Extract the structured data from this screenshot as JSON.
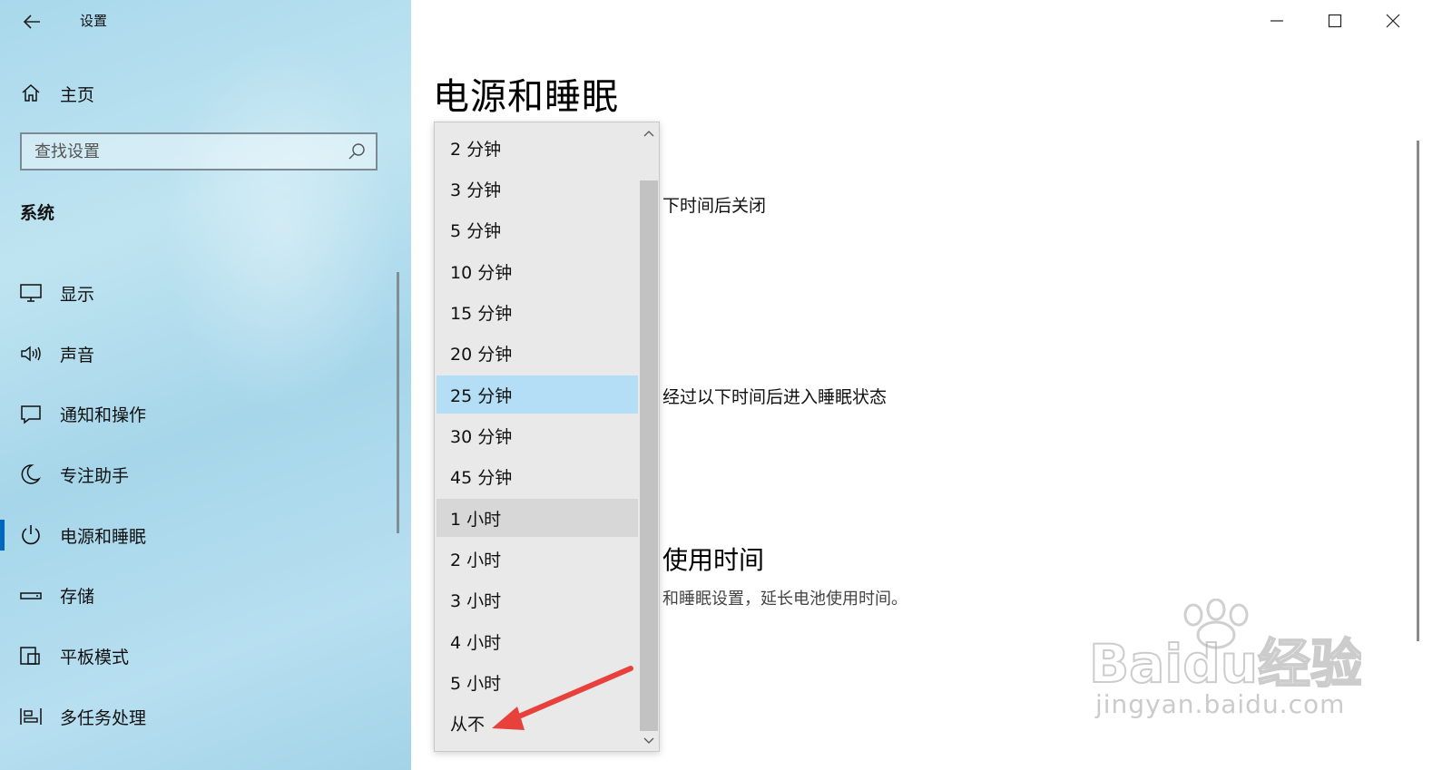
{
  "window": {
    "title": "设置"
  },
  "sidebar": {
    "home_label": "主页",
    "search_placeholder": "查找设置",
    "section_header": "系统",
    "items": [
      {
        "label": "显示",
        "icon": "monitor-icon"
      },
      {
        "label": "声音",
        "icon": "speaker-icon"
      },
      {
        "label": "通知和操作",
        "icon": "notification-icon"
      },
      {
        "label": "专注助手",
        "icon": "moon-icon"
      },
      {
        "label": "电源和睡眠",
        "icon": "power-icon",
        "active": true
      },
      {
        "label": "存储",
        "icon": "storage-icon"
      },
      {
        "label": "平板模式",
        "icon": "tablet-icon"
      },
      {
        "label": "多任务处理",
        "icon": "multitask-icon"
      }
    ]
  },
  "main": {
    "title": "电源和睡眠",
    "screen_text_fragment": "下时间后关闭",
    "sleep_text_fragment": "经过以下时间后进入睡眠状态",
    "battery_heading_fragment": "使用时间",
    "battery_desc_fragment": "和睡眠设置，延长电池使用时间。"
  },
  "dropdown": {
    "options": [
      "2 分钟",
      "3 分钟",
      "5 分钟",
      "10 分钟",
      "15 分钟",
      "20 分钟",
      "25 分钟",
      "30 分钟",
      "45 分钟",
      "1 小时",
      "2 小时",
      "3 小时",
      "4 小时",
      "5 小时",
      "从不"
    ],
    "selected": "25 分钟",
    "hovered": "1 小时"
  },
  "watermark": {
    "brand": "Baidu经验",
    "url": "jingyan.baidu.com"
  },
  "colors": {
    "accent": "#0067c0",
    "selected_bg": "#b3def6",
    "arrow": "#e8413c"
  }
}
